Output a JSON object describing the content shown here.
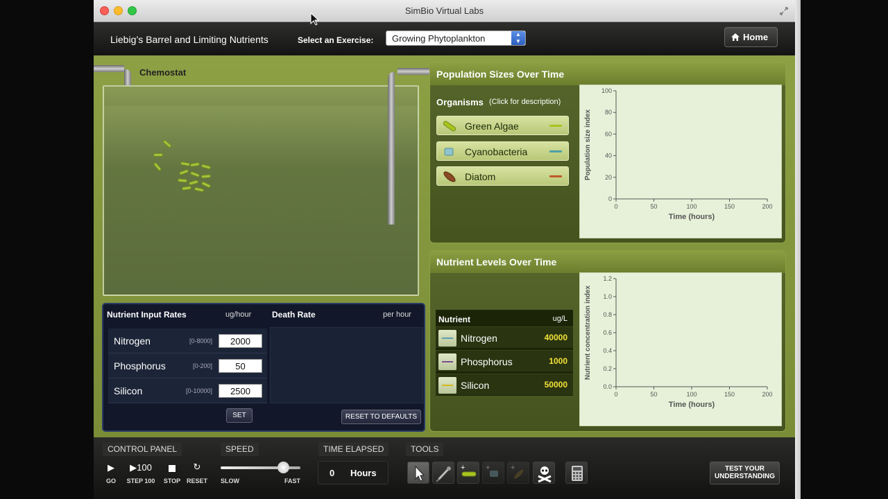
{
  "window": {
    "title": "SimBio Virtual Labs"
  },
  "header": {
    "lab_title": "Liebig’s Barrel and Limiting Nutrients",
    "select_label": "Select an Exercise:",
    "exercise_value": "Growing Phytoplankton",
    "home_label": "Home"
  },
  "chemostat": {
    "label": "Chemostat"
  },
  "controls": {
    "nutrient_header": "Nutrient Input Rates",
    "nutrient_unit": "ug/hour",
    "death_header": "Death Rate",
    "death_unit": "per hour",
    "rows": [
      {
        "name": "Nitrogen",
        "range": "[0-8000]",
        "value": "2000"
      },
      {
        "name": "Phosphorus",
        "range": "[0-200]",
        "value": "50"
      },
      {
        "name": "Silicon",
        "range": "[0-10000]",
        "value": "2500"
      }
    ],
    "set_label": "SET",
    "reset_label": "RESET TO DEFAULTS"
  },
  "population": {
    "title": "Population Sizes Over Time",
    "organisms_label": "Organisms",
    "organisms_hint": "(Click for description)",
    "organisms": [
      {
        "name": "Green Algae",
        "color": "#a8c41c"
      },
      {
        "name": "Cyanobacteria",
        "color": "#4f9fa6"
      },
      {
        "name": "Diatom",
        "color": "#c05a28"
      }
    ]
  },
  "nutrients": {
    "title": "Nutrient Levels Over Time",
    "col_label": "Nutrient",
    "col_unit": "ug/L",
    "items": [
      {
        "name": "Nitrogen",
        "value": "40000",
        "color": "#5f9fb4"
      },
      {
        "name": "Phosphorus",
        "value": "1000",
        "color": "#7a4c8c"
      },
      {
        "name": "Silicon",
        "value": "50000",
        "color": "#d6b81c"
      }
    ]
  },
  "chart_data": [
    {
      "type": "line",
      "title": "",
      "xlabel": "Time (hours)",
      "ylabel": "Population size index",
      "xlim": [
        0,
        200
      ],
      "ylim": [
        0,
        100
      ],
      "xticks": [
        "0",
        "50",
        "100",
        "150",
        "200"
      ],
      "yticks": [
        "0",
        "20",
        "40",
        "60",
        "80",
        "100"
      ],
      "series": [],
      "grid": false
    },
    {
      "type": "line",
      "title": "",
      "xlabel": "Time (hours)",
      "ylabel": "Nutrient concentration index",
      "xlim": [
        0,
        200
      ],
      "ylim": [
        0,
        1.2
      ],
      "xticks": [
        "0",
        "50",
        "100",
        "150",
        "200"
      ],
      "yticks": [
        "0.0",
        "0.2",
        "0.4",
        "0.6",
        "0.8",
        "1.0",
        "1.2"
      ],
      "series": [],
      "grid": false
    }
  ],
  "bottombar": {
    "control_panel_label": "CONTROL PANEL",
    "speed_label": "SPEED",
    "time_label": "TIME ELAPSED",
    "tools_label": "TOOLS",
    "go_label": "GO",
    "step_symbol": "▶100",
    "step_label": "STEP 100",
    "stop_label": "STOP",
    "reset_label": "RESET",
    "slow_label": "SLOW",
    "fast_label": "FAST",
    "speed_level": 0.78,
    "time_value": "0",
    "time_unit": "Hours",
    "test_label_1": "TEST YOUR",
    "test_label_2": "UNDERSTANDING"
  }
}
